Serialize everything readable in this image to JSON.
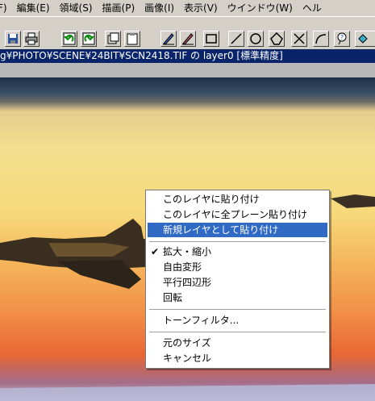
{
  "menubar": {
    "items": [
      "F)",
      "編集(E)",
      "領域(S)",
      "描画(P)",
      "画像(I)",
      "表示(V)",
      "ウインドウ(W)",
      "ヘル"
    ]
  },
  "pathbar": {
    "text": "g¥PHOTO¥SCENE¥24BIT¥SCN2418.TIF の layer0 [標準精度]"
  },
  "context_menu": {
    "items": [
      {
        "label": "このレイヤに貼り付け",
        "highlighted": false
      },
      {
        "label": "このレイヤに全プレーン貼り付け",
        "highlighted": false
      },
      {
        "label": "新規レイヤとして貼り付け",
        "highlighted": true
      },
      {
        "label": "拡大・縮小",
        "checked": true
      },
      {
        "label": "自由変形"
      },
      {
        "label": "平行四辺形"
      },
      {
        "label": "回転"
      },
      {
        "label": "トーンフィルタ..."
      },
      {
        "label": "元のサイズ"
      },
      {
        "label": "キャンセル"
      }
    ],
    "checkmark": "✔"
  },
  "toolbar": {
    "icons": [
      "save-icon",
      "print-icon",
      "undo-icon",
      "redo-icon",
      "copy-icon",
      "paste-icon",
      "pen-icon",
      "eraser-icon",
      "rectangle-icon",
      "line-icon",
      "circle-icon",
      "polygon-icon",
      "cross-icon",
      "curve-icon",
      "balloon-icon",
      "fill-icon"
    ]
  },
  "colors": {
    "highlight": "#316ac5",
    "titlebar": "#0a246a",
    "chrome": "#d4d0c8"
  }
}
